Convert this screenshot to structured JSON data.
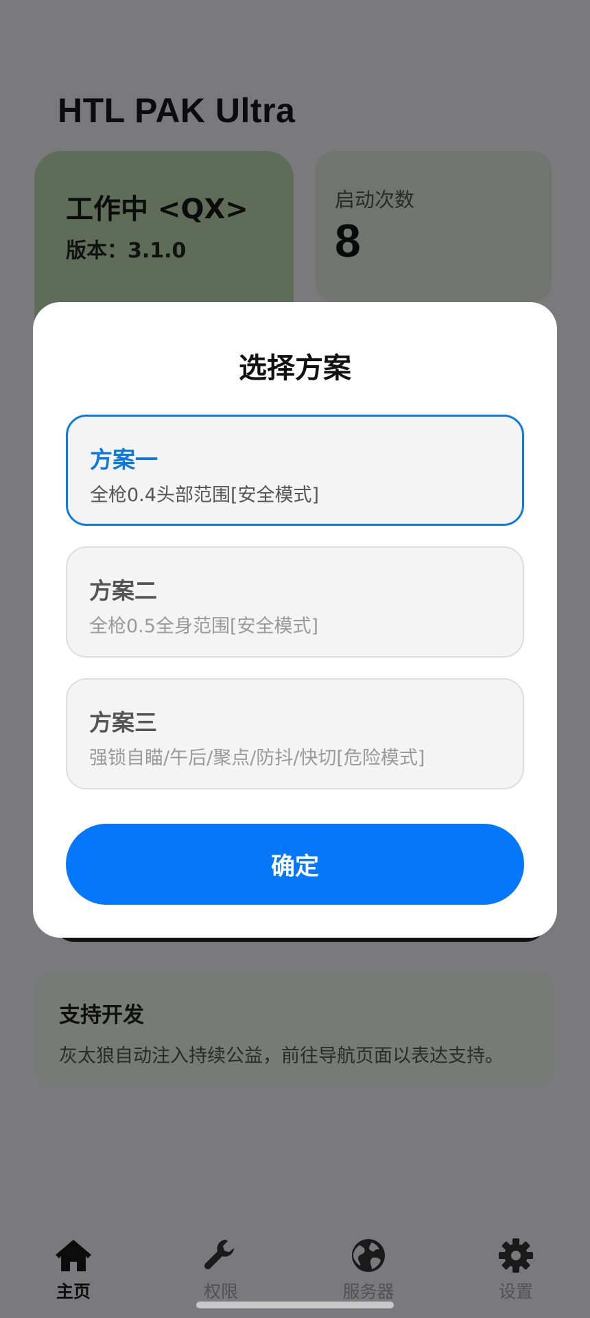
{
  "app": {
    "title": "HTL PAK Ultra"
  },
  "status": {
    "text": "工作中 <QX>",
    "version": "版本：3.1.0"
  },
  "launch": {
    "label": "启动次数",
    "count": "8"
  },
  "support": {
    "title": "支持开发",
    "text": "灰太狼自动注入持续公益，前往导航页面以表达支持。"
  },
  "modal": {
    "title": "选择方案",
    "options": [
      {
        "name": "方案一",
        "desc": "全枪0.4头部范围[安全模式]",
        "selected": true
      },
      {
        "name": "方案二",
        "desc": "全枪0.5全身范围[安全模式]",
        "selected": false
      },
      {
        "name": "方案三",
        "desc": "强锁自瞄/午后/聚点/防抖/快切[危险模式]",
        "selected": false
      }
    ],
    "confirm_label": "确定"
  },
  "nav": {
    "items": [
      {
        "label": "主页",
        "icon": "home-icon",
        "active": true
      },
      {
        "label": "权限",
        "icon": "wrench-icon",
        "active": false
      },
      {
        "label": "服务器",
        "icon": "globe-icon",
        "active": false
      },
      {
        "label": "设置",
        "icon": "gear-icon",
        "active": false
      }
    ]
  },
  "colors": {
    "accent": "#0477fb",
    "selected_border": "#0a7ae6",
    "scrim": "#7a797b"
  }
}
